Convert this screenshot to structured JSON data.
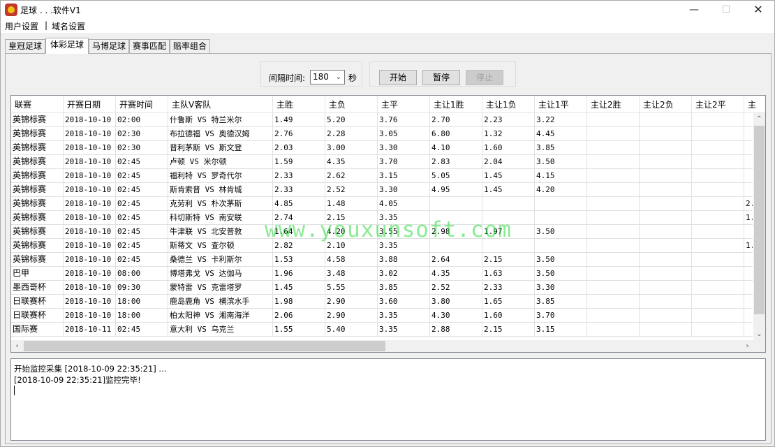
{
  "window": {
    "title": "足球 . . .软件V1",
    "controls": {
      "minimize": "—",
      "maximize": "☐",
      "close": "✕"
    }
  },
  "menu": [
    {
      "label": "用户设置"
    },
    {
      "label": "域名设置"
    }
  ],
  "menu_separator": "|",
  "tabs": [
    {
      "label": "皇冠足球",
      "active": false
    },
    {
      "label": "体彩足球",
      "active": true
    },
    {
      "label": "马博足球",
      "active": false
    },
    {
      "label": "赛事匹配",
      "active": false
    },
    {
      "label": "赔率组合",
      "active": false
    }
  ],
  "controls": {
    "interval_label": "间隔时间:",
    "interval_value": "180",
    "interval_unit": "秒",
    "start_label": "开始",
    "pause_label": "暂停",
    "stop_label": "停止"
  },
  "table": {
    "columns": [
      "联赛",
      "开赛日期",
      "开赛时间",
      "主队V客队",
      "主胜",
      "主负",
      "主平",
      "主让1胜",
      "主让1负",
      "主让1平",
      "主让2胜",
      "主让2负",
      "主让2平",
      "主"
    ],
    "rows": [
      [
        "英锦标赛",
        "2018-10-10",
        "02:00",
        "什鲁斯 VS 特兰米尔",
        "1.49",
        "5.20",
        "3.76",
        "2.70",
        "2.23",
        "3.22",
        "",
        "",
        "",
        ""
      ],
      [
        "英锦标赛",
        "2018-10-10",
        "02:30",
        "布拉德福 VS 奥德汉姆",
        "2.76",
        "2.28",
        "3.05",
        "6.80",
        "1.32",
        "4.45",
        "",
        "",
        "",
        ""
      ],
      [
        "英锦标赛",
        "2018-10-10",
        "02:30",
        "普利茅斯 VS 斯文登",
        "2.03",
        "3.00",
        "3.30",
        "4.10",
        "1.60",
        "3.85",
        "",
        "",
        "",
        ""
      ],
      [
        "英锦标赛",
        "2018-10-10",
        "02:45",
        "卢顿 VS 米尔顿",
        "1.59",
        "4.35",
        "3.70",
        "2.83",
        "2.04",
        "3.50",
        "",
        "",
        "",
        ""
      ],
      [
        "英锦标赛",
        "2018-10-10",
        "02:45",
        "福利特 VS 罗奇代尔",
        "2.33",
        "2.62",
        "3.15",
        "5.05",
        "1.45",
        "4.15",
        "",
        "",
        "",
        ""
      ],
      [
        "英锦标赛",
        "2018-10-10",
        "02:45",
        "斯肯索普 VS 林肯城",
        "2.33",
        "2.52",
        "3.30",
        "4.95",
        "1.45",
        "4.20",
        "",
        "",
        "",
        ""
      ],
      [
        "英锦标赛",
        "2018-10-10",
        "02:45",
        "克劳利 VS 朴次茅斯",
        "4.85",
        "1.48",
        "4.05",
        "",
        "",
        "",
        "",
        "",
        "",
        "2."
      ],
      [
        "英锦标赛",
        "2018-10-10",
        "02:45",
        "科切斯特 VS 南安联",
        "2.74",
        "2.15",
        "3.35",
        "",
        "",
        "",
        "",
        "",
        "",
        "1."
      ],
      [
        "英锦标赛",
        "2018-10-10",
        "02:45",
        "牛津联 VS 北安普敦",
        "1.64",
        "4.20",
        "3.55",
        "2.98",
        "1.97",
        "3.50",
        "",
        "",
        "",
        ""
      ],
      [
        "英锦标赛",
        "2018-10-10",
        "02:45",
        "斯蒂文 VS 查尔顿",
        "2.82",
        "2.10",
        "3.35",
        "",
        "",
        "",
        "",
        "",
        "",
        "1."
      ],
      [
        "英锦标赛",
        "2018-10-10",
        "02:45",
        "桑德兰 VS 卡利斯尔",
        "1.53",
        "4.58",
        "3.88",
        "2.64",
        "2.15",
        "3.50",
        "",
        "",
        "",
        ""
      ],
      [
        "巴甲",
        "2018-10-10",
        "08:00",
        "博塔弗戈 VS 达伽马",
        "1.96",
        "3.48",
        "3.02",
        "4.35",
        "1.63",
        "3.50",
        "",
        "",
        "",
        ""
      ],
      [
        "墨西哥杯",
        "2018-10-10",
        "09:30",
        "蒙特雷 VS 克雷塔罗",
        "1.45",
        "5.55",
        "3.85",
        "2.52",
        "2.33",
        "3.30",
        "",
        "",
        "",
        ""
      ],
      [
        "日联赛杯",
        "2018-10-10",
        "18:00",
        "鹿岛鹿角 VS 横滨水手",
        "1.98",
        "2.90",
        "3.60",
        "3.80",
        "1.65",
        "3.85",
        "",
        "",
        "",
        ""
      ],
      [
        "日联赛杯",
        "2018-10-10",
        "18:00",
        "柏太阳神 VS 湘南海洋",
        "2.06",
        "2.90",
        "3.35",
        "4.30",
        "1.60",
        "3.70",
        "",
        "",
        "",
        ""
      ],
      [
        "国际赛",
        "2018-10-11",
        "02:45",
        "意大利 VS 乌克兰",
        "1.55",
        "5.40",
        "3.35",
        "2.88",
        "2.15",
        "3.15",
        "",
        "",
        "",
        ""
      ]
    ]
  },
  "watermark": "www.youxunsoft.com",
  "log": {
    "lines": [
      "开始监控采集 [2018-10-09 22:35:21] ...",
      "[2018-10-09 22:35:21]监控完毕!"
    ]
  }
}
